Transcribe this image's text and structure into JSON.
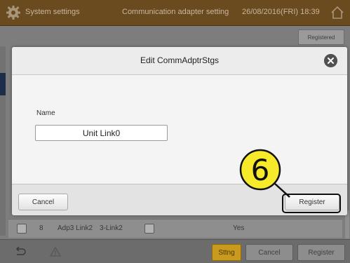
{
  "header": {
    "app_title": "System settings",
    "screen_title": "Communication adapter setting",
    "datetime": "26/08/2016(FRI) 18:39",
    "gear_icon": "gear-icon",
    "home_icon": "home-icon"
  },
  "background": {
    "registered_label": "Registered",
    "row": {
      "number": "8",
      "adapter": "Adp3 Link2",
      "link": "3-Link2",
      "status": "Yes"
    }
  },
  "bottom_bar": {
    "back_icon": "back-arrow-icon",
    "warning_icon": "warning-icon",
    "sttng_label": "Sttng",
    "cancel_label": "Cancel",
    "register_label": "Register",
    "sttng_color": "#c99a1b"
  },
  "dialog": {
    "title": "Edit CommAdptrStgs",
    "close_icon": "close-icon",
    "name_label": "Name",
    "name_value": "Unit Link0",
    "cancel_label": "Cancel",
    "register_label": "Register"
  },
  "callout": {
    "step_number": "6",
    "color": "#f7ea2a"
  }
}
